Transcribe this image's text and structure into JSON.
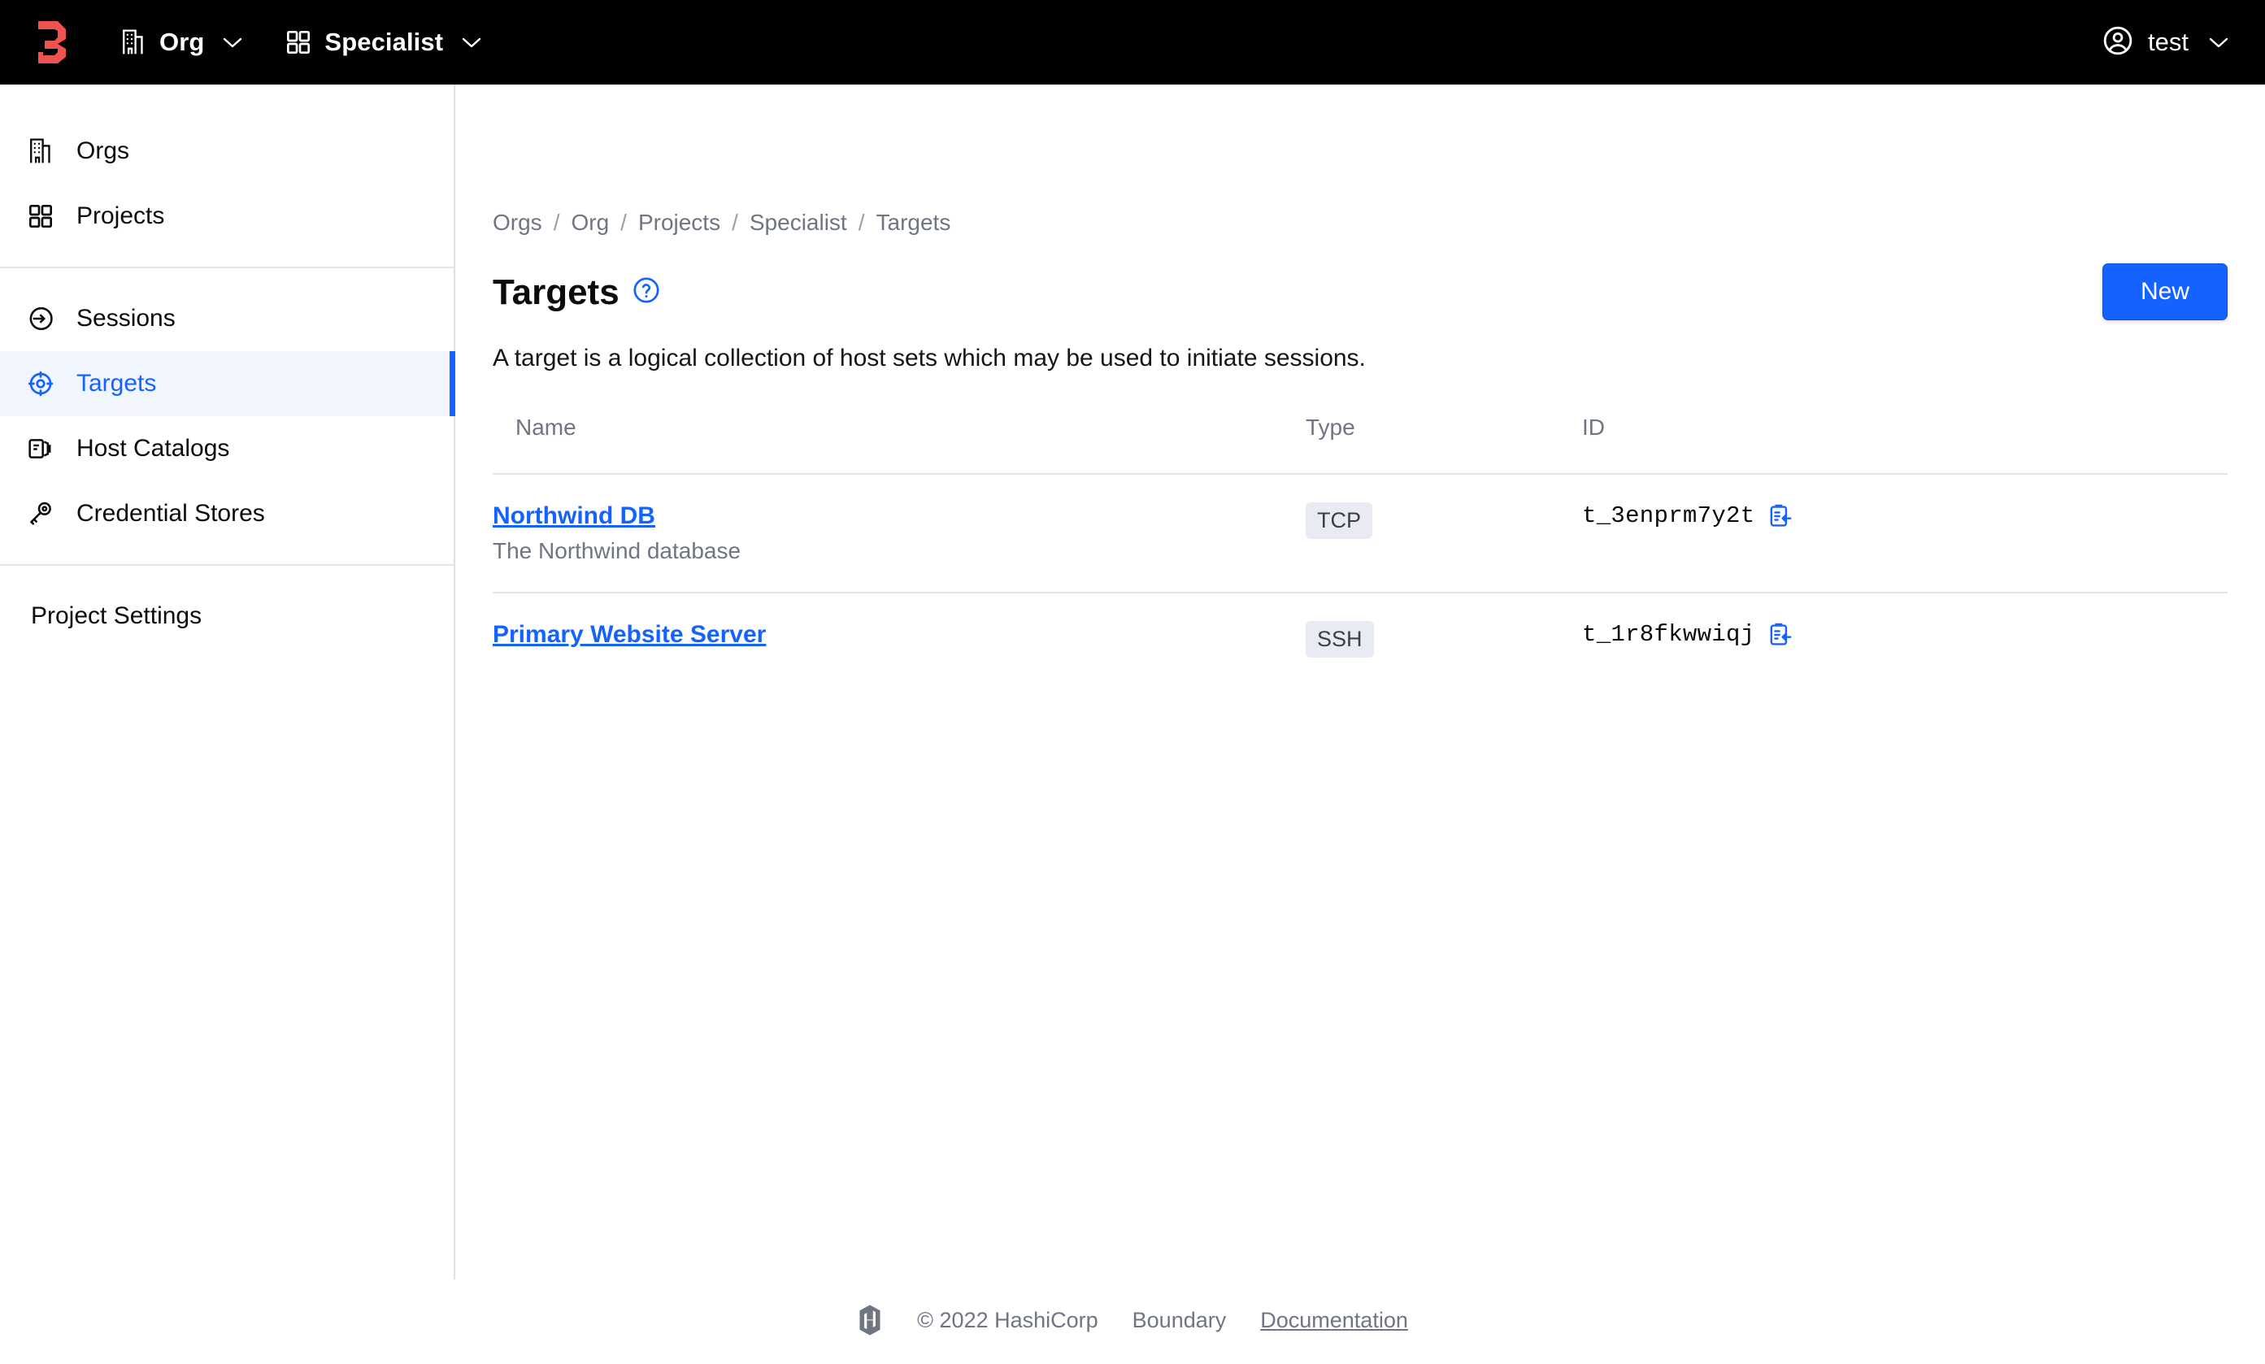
{
  "topnav": {
    "brand_icon": "boundary-logo",
    "brand_color": "#ef5350",
    "org": {
      "icon": "building-icon",
      "label": "Org",
      "chevron": "chevron-down-icon"
    },
    "scope": {
      "icon": "grid-icon",
      "label": "Specialist",
      "chevron": "chevron-down-icon"
    },
    "user": {
      "icon": "user-circle-icon",
      "label": "test",
      "chevron": "chevron-down-icon"
    }
  },
  "sidebar": {
    "group_one": [
      {
        "label": "Orgs",
        "icon": "building-icon",
        "active": false
      },
      {
        "label": "Projects",
        "icon": "grid-icon",
        "active": false
      }
    ],
    "group_two": [
      {
        "label": "Sessions",
        "icon": "session-arrow-icon",
        "active": false
      },
      {
        "label": "Targets",
        "icon": "target-crosshair-icon",
        "active": true
      },
      {
        "label": "Host Catalogs",
        "icon": "host-catalog-icon",
        "active": false
      },
      {
        "label": "Credential Stores",
        "icon": "key-icon",
        "active": false
      }
    ],
    "group_three": [
      {
        "label": "Project Settings"
      }
    ],
    "active_color": "#1563ff",
    "active_bg": "#f1f5fd"
  },
  "breadcrumb": [
    "Orgs",
    "Org",
    "Projects",
    "Specialist",
    "Targets"
  ],
  "breadcrumb_separator": "/",
  "main": {
    "title": "Targets",
    "help_icon": "question-circle-icon",
    "new_button": "New",
    "description": "A target is a logical collection of host sets which may be used to initiate sessions.",
    "accent_color": "#1563ff"
  },
  "table": {
    "columns": [
      "Name",
      "Type",
      "ID"
    ],
    "rows": [
      {
        "name": "Northwind DB",
        "description": "The Northwind database",
        "type": "TCP",
        "id": "t_3enprm7y2t",
        "copy_icon": "copy-clipboard-icon"
      },
      {
        "name": "Primary Website Server",
        "description": "",
        "type": "SSH",
        "id": "t_1r8fkwwiqj",
        "copy_icon": "copy-clipboard-icon"
      }
    ]
  },
  "footer": {
    "logo_icon": "hashicorp-logo-icon",
    "copyright": "© 2022 HashiCorp",
    "product": "Boundary",
    "docs_link": "Documentation"
  }
}
